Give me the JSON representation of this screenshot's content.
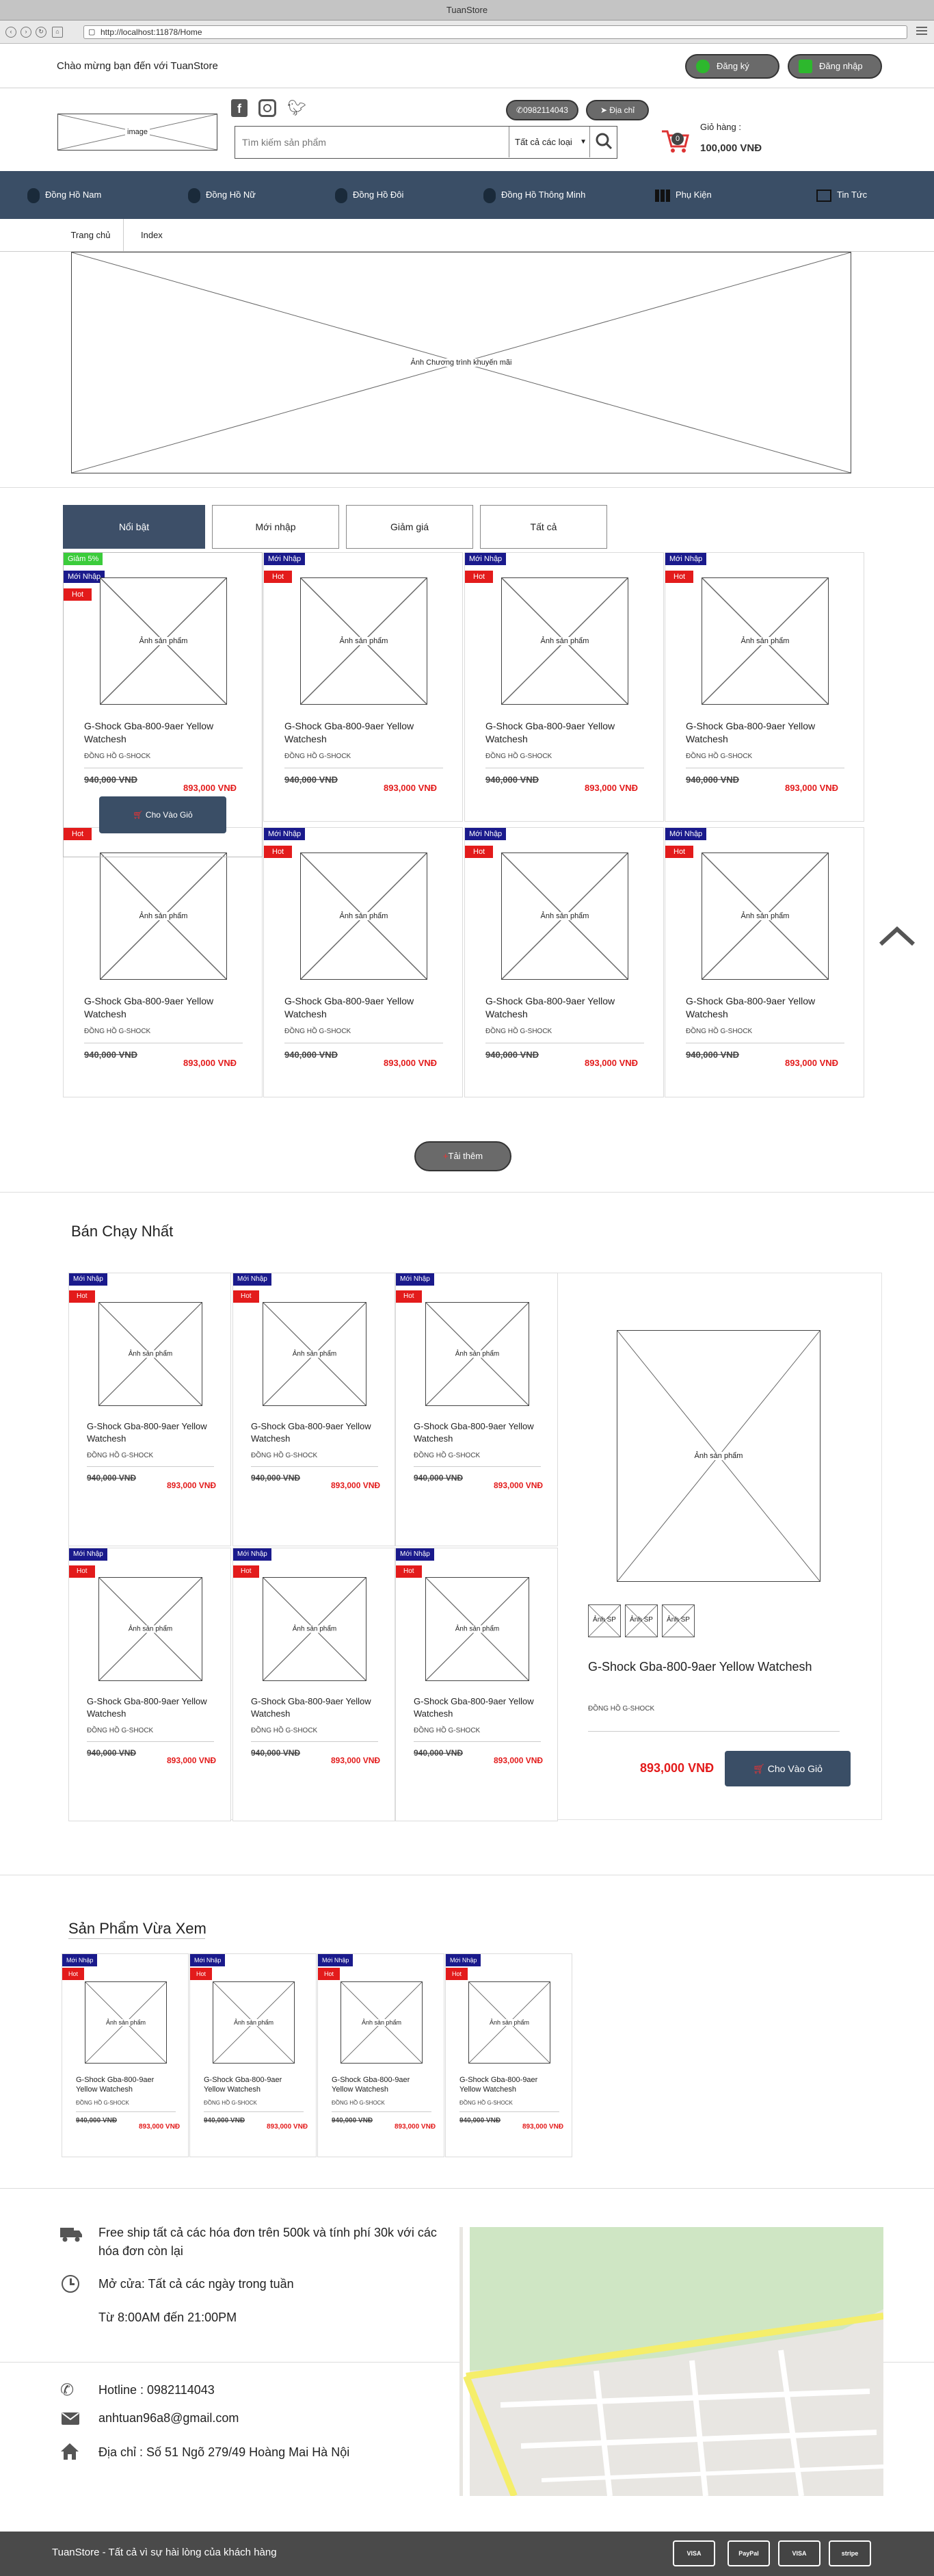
{
  "window": {
    "title": "TuanStore",
    "url": "http://localhost:11878/Home"
  },
  "topbar": {
    "welcome": "Chào mừng bạn đến với TuanStore",
    "register": "Đăng ký",
    "login": "Đăng nhập"
  },
  "header": {
    "logo_caption": "image",
    "phone": "0982114043",
    "address": "Địa chỉ",
    "search_placeholder": "Tìm kiếm sản phẩm",
    "category_select": "Tất cả các loại",
    "cart_label": "Giỏ hàng :",
    "cart_total": "100,000 VNĐ",
    "cart_count": "0"
  },
  "nav": {
    "items": [
      {
        "label": "Đồng Hồ Nam"
      },
      {
        "label": "Đồng Hồ Nữ"
      },
      {
        "label": "Đồng Hồ Đôi"
      },
      {
        "label": "Đồng Hồ Thông Minh"
      },
      {
        "label": "Phụ Kiện"
      },
      {
        "label": "Tin Tức"
      }
    ]
  },
  "breadcrumb": {
    "home": "Trang chủ",
    "current": "Index"
  },
  "banner": {
    "caption": "Ảnh Chương trình khuyến mãi"
  },
  "tabs": [
    "Nổi bật",
    "Mới nhập",
    "Giảm giá",
    "Tất cả"
  ],
  "product": {
    "image_caption": "Ảnh sản phẩm",
    "name": "G-Shock Gba-800-9aer Yellow Watchesh",
    "category": "ĐỒNG HỒ G-SHOCK",
    "old_price": "940,000 VNĐ",
    "new_price": "893,000 VNĐ"
  },
  "badges": {
    "new": "Mới Nhập",
    "hot": "Hot",
    "sale": "Giảm 5%"
  },
  "buttons": {
    "add_to_cart": "Cho Vào Giỏ",
    "load_more": "Tải thêm"
  },
  "bestseller": {
    "title": "Bán Chạy Nhất",
    "thumb_caption": "Ảnh SP",
    "featured_price": "893,000 VNĐ"
  },
  "recent": {
    "title": "Sản Phẩm Vừa Xem"
  },
  "footer": {
    "shipping": "Free ship tất cả các hóa đơn trên 500k và tính phí 30k với các hóa đơn còn lại",
    "open": "Mở cửa: Tất cả các ngày trong tuần",
    "hours": "Từ 8:00AM đến 21:00PM",
    "hotline": "Hotline : 0982114043",
    "email": "anhtuan96a8@gmail.com",
    "address": "Địa chỉ : Số 51 Ngõ 279/49 Hoàng Mai Hà Nội",
    "copyright": "TuanStore - Tất cả vì sự hài lòng của khách hàng",
    "payments": [
      "VISA",
      "PayPal",
      "VISA",
      "stripe"
    ]
  },
  "colors": {
    "nav": "#3a4e66",
    "hot": "#e31b1b",
    "new": "#1a1a8c",
    "sale": "#3bcc3b"
  }
}
